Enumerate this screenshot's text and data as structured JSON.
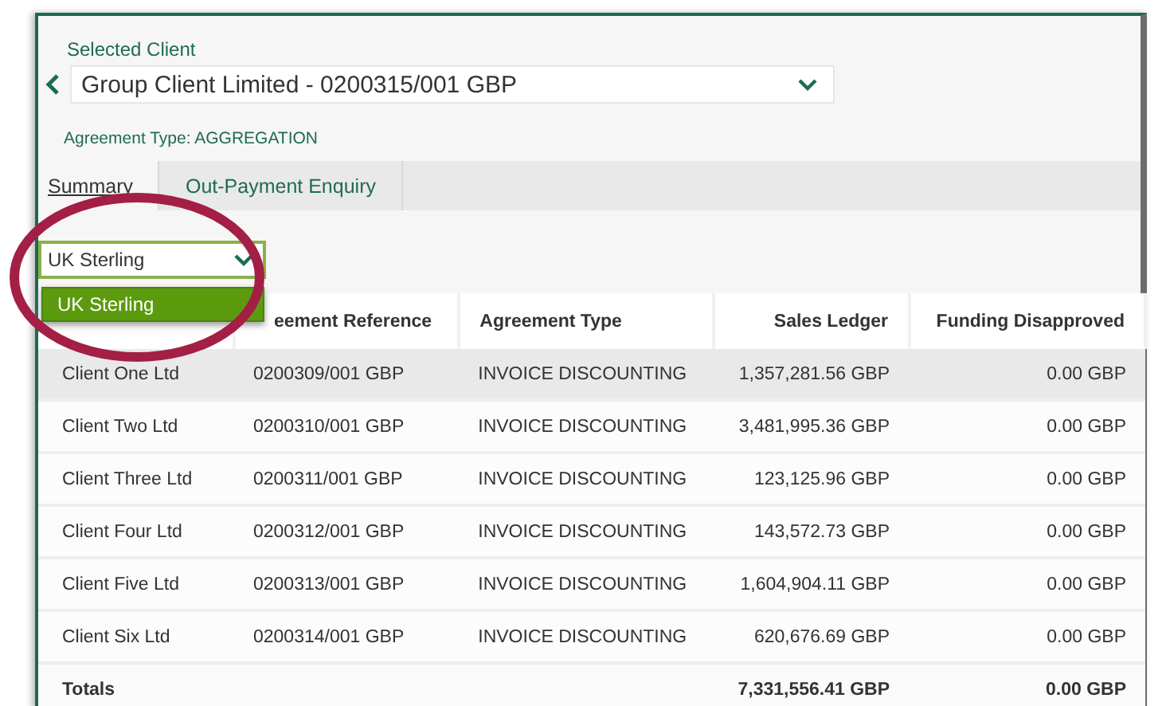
{
  "selected_client": {
    "label": "Selected Client",
    "value": "Group Client Limited - 0200315/001 GBP"
  },
  "agreement_type": "Agreement Type: AGGREGATION",
  "tabs": [
    {
      "label": "Summary",
      "selected": true
    },
    {
      "label": "Out-Payment Enquiry",
      "selected": false
    }
  ],
  "currency_select": {
    "value": "UK Sterling",
    "expanded": true,
    "options": [
      {
        "label": "UK Sterling",
        "selected": true
      }
    ]
  },
  "table": {
    "columns": [
      "",
      "eement Reference",
      "Agreement Type",
      "Sales Ledger",
      "Funding Disapproved"
    ],
    "rows": [
      {
        "cells": [
          "Client One Ltd",
          "0200309/001 GBP",
          "INVOICE DISCOUNTING",
          "1,357,281.56 GBP",
          "0.00 GBP"
        ],
        "hovered": true
      },
      {
        "cells": [
          "Client Two Ltd",
          "0200310/001 GBP",
          "INVOICE DISCOUNTING",
          "3,481,995.36 GBP",
          "0.00 GBP"
        ],
        "hovered": false
      },
      {
        "cells": [
          "Client Three Ltd",
          "0200311/001 GBP",
          "INVOICE DISCOUNTING",
          "123,125.96 GBP",
          "0.00 GBP"
        ],
        "hovered": false
      },
      {
        "cells": [
          "Client Four Ltd",
          "0200312/001 GBP",
          "INVOICE DISCOUNTING",
          "143,572.73 GBP",
          "0.00 GBP"
        ],
        "hovered": false
      },
      {
        "cells": [
          "Client Five Ltd",
          "0200313/001 GBP",
          "INVOICE DISCOUNTING",
          "1,604,904.11 GBP",
          "0.00 GBP"
        ],
        "hovered": false
      },
      {
        "cells": [
          "Client Six Ltd",
          "0200314/001 GBP",
          "INVOICE DISCOUNTING",
          "620,676.69 GBP",
          "0.00 GBP"
        ],
        "hovered": false
      }
    ],
    "totals": {
      "label": "Totals",
      "sales_ledger": "7,331,556.41 GBP",
      "funding_disapproved": "0.00 GBP"
    }
  }
}
